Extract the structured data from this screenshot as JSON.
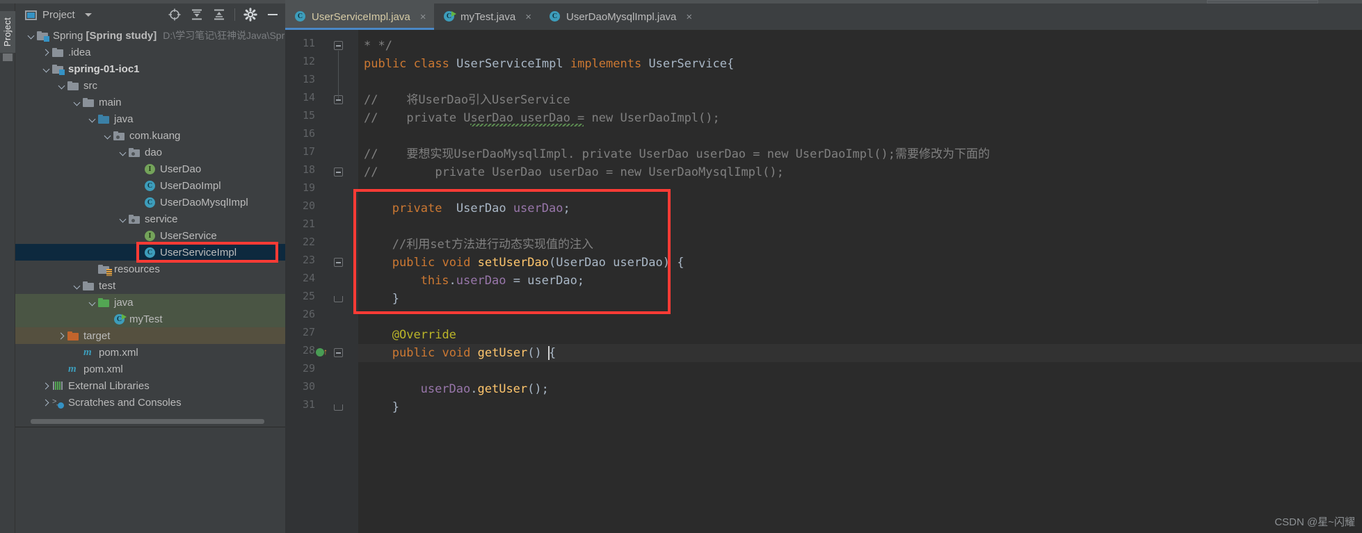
{
  "window": {
    "theme_bg": "#3c3f41",
    "editor_bg": "#2b2b2b",
    "accent": "#4a88c7",
    "annotation_color": "#fd3b35"
  },
  "project_panel": {
    "vertical_tab_label": "Project",
    "title": "Project",
    "toolbar_icons": [
      {
        "name": "locate-target-icon",
        "glyph": "target"
      },
      {
        "name": "expand-all-icon",
        "glyph": "expand"
      },
      {
        "name": "collapse-all-icon",
        "glyph": "collapse"
      },
      {
        "name": "settings-gear-icon",
        "glyph": "gear"
      },
      {
        "name": "hide-window-icon",
        "glyph": "minus"
      }
    ],
    "tree": [
      {
        "label": "Spring [Spring study]",
        "name": "Spring",
        "bold_part": "[Spring study]",
        "path": "D:\\学习笔记\\狂神说Java\\Spr",
        "depth": 0,
        "icon": "module-folder",
        "arrow": "down",
        "highlight": "none"
      },
      {
        "label": ".idea",
        "depth": 1,
        "icon": "folder-gray",
        "arrow": "right",
        "highlight": "none"
      },
      {
        "label": "spring-01-ioc1",
        "depth": 1,
        "icon": "module-folder",
        "arrow": "down",
        "bold": true,
        "highlight": "none"
      },
      {
        "label": "src",
        "depth": 2,
        "icon": "folder-gray",
        "arrow": "down",
        "highlight": "none"
      },
      {
        "label": "main",
        "depth": 3,
        "icon": "folder-gray",
        "arrow": "down",
        "highlight": "none"
      },
      {
        "label": "java",
        "depth": 4,
        "icon": "folder-blue-source",
        "arrow": "down",
        "highlight": "none"
      },
      {
        "label": "com.kuang",
        "depth": 5,
        "icon": "package",
        "arrow": "down",
        "highlight": "none"
      },
      {
        "label": "dao",
        "depth": 6,
        "icon": "package",
        "arrow": "down",
        "highlight": "none"
      },
      {
        "label": "UserDao",
        "depth": 7,
        "icon": "interface",
        "arrow": "none",
        "highlight": "none"
      },
      {
        "label": "UserDaoImpl",
        "depth": 7,
        "icon": "class",
        "arrow": "none",
        "highlight": "none"
      },
      {
        "label": "UserDaoMysqlImpl",
        "depth": 7,
        "icon": "class",
        "arrow": "none",
        "highlight": "none"
      },
      {
        "label": "service",
        "depth": 6,
        "icon": "package",
        "arrow": "down",
        "highlight": "none"
      },
      {
        "label": "UserService",
        "depth": 7,
        "icon": "interface",
        "arrow": "none",
        "highlight": "none"
      },
      {
        "label": "UserServiceImpl",
        "depth": 7,
        "icon": "class",
        "arrow": "none",
        "highlight": "selected",
        "annotated": true
      },
      {
        "label": "resources",
        "depth": 4,
        "icon": "folder-resources",
        "arrow": "none",
        "highlight": "none"
      },
      {
        "label": "test",
        "depth": 3,
        "icon": "folder-gray",
        "arrow": "down",
        "highlight": "none"
      },
      {
        "label": "java",
        "depth": 4,
        "icon": "folder-green-test",
        "arrow": "down",
        "highlight": "green"
      },
      {
        "label": "myTest",
        "depth": 5,
        "icon": "class-runnable",
        "arrow": "none",
        "highlight": "green"
      },
      {
        "label": "target",
        "depth": 2,
        "icon": "folder-orange",
        "arrow": "right",
        "highlight": "brown"
      },
      {
        "label": "pom.xml",
        "depth": 3,
        "icon": "maven",
        "arrow": "none",
        "highlight": "none"
      },
      {
        "label": "pom.xml",
        "depth": 2,
        "icon": "maven",
        "arrow": "none",
        "highlight": "none"
      },
      {
        "label": "External Libraries",
        "depth": 1,
        "icon": "libraries",
        "arrow": "right",
        "highlight": "none"
      },
      {
        "label": "Scratches and Consoles",
        "depth": 1,
        "icon": "scratches",
        "arrow": "right",
        "highlight": "none"
      }
    ]
  },
  "editor": {
    "tabs": [
      {
        "label": "UserServiceImpl.java",
        "icon": "class-icon",
        "active": true,
        "close_glyph": "×"
      },
      {
        "label": "myTest.java",
        "icon": "class-runnable-icon",
        "active": false,
        "close_glyph": "×"
      },
      {
        "label": "UserDaoMysqlImpl.java",
        "icon": "class-icon",
        "active": false,
        "close_glyph": "×"
      }
    ],
    "first_line_number": 11,
    "current_line": 28,
    "lines": [
      {
        "n": 11,
        "indent": 0,
        "fold": "end-top",
        "tokens": [
          {
            "t": "* */",
            "c": "cmt"
          }
        ]
      },
      {
        "n": 12,
        "indent": 0,
        "fold": "",
        "tokens": [
          {
            "t": "public ",
            "c": "kw"
          },
          {
            "t": "class ",
            "c": "kw"
          },
          {
            "t": "UserServiceImpl ",
            "c": "plain"
          },
          {
            "t": "implements ",
            "c": "kw"
          },
          {
            "t": "UserService{",
            "c": "plain"
          }
        ]
      },
      {
        "n": 13,
        "indent": 0,
        "fold": "",
        "tokens": []
      },
      {
        "n": 14,
        "indent": 0,
        "fold": "start",
        "tokens": [
          {
            "t": "//    将UserDao引入UserService",
            "c": "cmt"
          }
        ]
      },
      {
        "n": 15,
        "indent": 0,
        "fold": "",
        "tokens": [
          {
            "t": "//    private UserDao userDao = new UserDaoImpl();",
            "c": "cmt"
          }
        ]
      },
      {
        "n": 16,
        "indent": 0,
        "fold": "",
        "tokens": []
      },
      {
        "n": 17,
        "indent": 0,
        "fold": "",
        "tokens": [
          {
            "t": "//    要想实现UserDaoMysqlImpl. private UserDao userDao = new UserDaoImpl();需要修改为下面的",
            "c": "cmt"
          }
        ]
      },
      {
        "n": 18,
        "indent": 0,
        "fold": "start",
        "tokens": [
          {
            "t": "//        private UserDao userDao = new UserDaoMysqlImpl();",
            "c": "cmt"
          }
        ]
      },
      {
        "n": 19,
        "indent": 0,
        "fold": "",
        "tokens": []
      },
      {
        "n": 20,
        "indent": 1,
        "fold": "",
        "tokens": [
          {
            "t": "private ",
            "c": "kw"
          },
          {
            "t": " UserDao ",
            "c": "plain"
          },
          {
            "t": "userDao",
            "c": "field"
          },
          {
            "t": ";",
            "c": "plain"
          }
        ]
      },
      {
        "n": 21,
        "indent": 0,
        "fold": "",
        "tokens": []
      },
      {
        "n": 22,
        "indent": 1,
        "fold": "",
        "tokens": [
          {
            "t": "//利用set方法进行动态实现值的注入",
            "c": "cmt"
          }
        ]
      },
      {
        "n": 23,
        "indent": 1,
        "fold": "start",
        "tokens": [
          {
            "t": "public ",
            "c": "kw"
          },
          {
            "t": "void ",
            "c": "kw"
          },
          {
            "t": "setUserDao",
            "c": "method"
          },
          {
            "t": "(UserDao userDao) {",
            "c": "plain"
          }
        ]
      },
      {
        "n": 24,
        "indent": 2,
        "fold": "",
        "tokens": [
          {
            "t": "this",
            "c": "kw"
          },
          {
            "t": ".",
            "c": "plain"
          },
          {
            "t": "userDao",
            "c": "field"
          },
          {
            "t": " = userDao;",
            "c": "plain"
          }
        ]
      },
      {
        "n": 25,
        "indent": 1,
        "fold": "end",
        "tokens": [
          {
            "t": "}",
            "c": "plain"
          }
        ]
      },
      {
        "n": 26,
        "indent": 0,
        "fold": "",
        "tokens": []
      },
      {
        "n": 27,
        "indent": 1,
        "fold": "",
        "tokens": [
          {
            "t": "@Override",
            "c": "annot"
          }
        ]
      },
      {
        "n": 28,
        "indent": 1,
        "fold": "start",
        "gutter_run": true,
        "tokens": [
          {
            "t": "public ",
            "c": "kw"
          },
          {
            "t": "void ",
            "c": "kw"
          },
          {
            "t": "getUser",
            "c": "method"
          },
          {
            "t": "() ",
            "c": "plain"
          },
          {
            "t": "{",
            "c": "plain"
          }
        ]
      },
      {
        "n": 29,
        "indent": 0,
        "fold": "",
        "tokens": []
      },
      {
        "n": 30,
        "indent": 2,
        "fold": "",
        "tokens": [
          {
            "t": "userDao",
            "c": "field"
          },
          {
            "t": ".",
            "c": "plain"
          },
          {
            "t": "getUser",
            "c": "method"
          },
          {
            "t": "();",
            "c": "plain"
          }
        ]
      },
      {
        "n": 31,
        "indent": 1,
        "fold": "end",
        "tokens": [
          {
            "t": "}",
            "c": "plain"
          }
        ]
      }
    ],
    "annotation_box_label": "red-highlight-rect-lines-20-25"
  },
  "watermark": "CSDN @星~闪耀"
}
